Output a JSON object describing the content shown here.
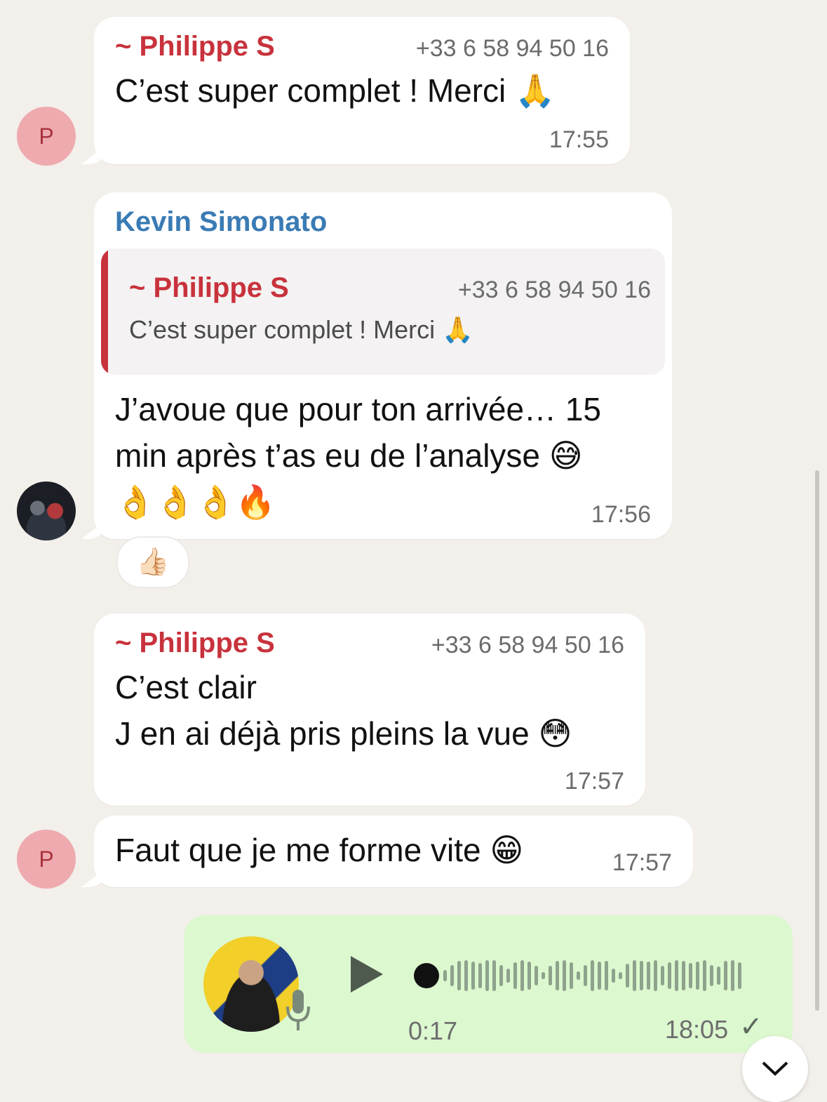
{
  "messages": [
    {
      "sender": "~ Philippe S",
      "phone": "+33 6 58 94 50 16",
      "text": "C’est super complet ! Merci 🙏",
      "time": "17:55",
      "avatar_letter": "P"
    },
    {
      "sender": "Kevin Simonato",
      "quote": {
        "sender": "~ Philippe S",
        "phone": "+33 6 58 94 50 16",
        "text": "C’est super complet ! Merci 🙏"
      },
      "text": "J’avoue que pour ton arrivée… 15\nmin après t’as eu de l’analyse 😅\n👌👌👌🔥",
      "time": "17:56",
      "reaction": "👍🏻"
    },
    {
      "sender": "~ Philippe S",
      "phone": "+33 6 58 94 50 16",
      "text": "C’est clair\nJ en ai déjà pris pleins la vue 😳",
      "time": "17:57"
    },
    {
      "text": "Faut que je me forme vite 😁",
      "time": "17:57",
      "avatar_letter": "P"
    }
  ],
  "voice_message": {
    "duration": "0:17",
    "time": "18:05",
    "status": "✓",
    "play_icon": "play-icon",
    "mic_icon": "microphone-icon"
  },
  "colors": {
    "background": "#f3efea",
    "incoming": "#ffffff",
    "outgoing": "#dcf8cf",
    "sender_red": "#c8323c",
    "sender_blue": "#3a7bb4"
  }
}
